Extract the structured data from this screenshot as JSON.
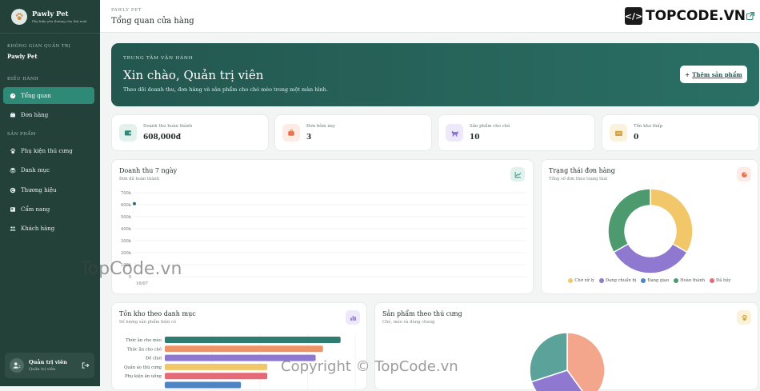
{
  "brand": {
    "name": "Pawly Pet",
    "tagline": "Phụ kiện yêu thương cho thú nuôi"
  },
  "sidebar": {
    "workspace_section": "KHÔNG GIAN QUẢN TRỊ",
    "workspace_name": "Pawly Pet",
    "ops_section": "ĐIỀU HÀNH",
    "products_section": "SẢN PHẨM",
    "items": [
      {
        "label": "Tổng quan",
        "icon": "dashboard-icon",
        "active": true
      },
      {
        "label": "Đơn hàng",
        "icon": "orders-icon",
        "active": false
      },
      {
        "label": "Phụ kiện thú cưng",
        "icon": "paw-icon",
        "active": false
      },
      {
        "label": "Danh mục",
        "icon": "layers-icon",
        "active": false
      },
      {
        "label": "Thương hiệu",
        "icon": "copyright-icon",
        "active": false
      },
      {
        "label": "Cẩm nang",
        "icon": "book-icon",
        "active": false
      },
      {
        "label": "Khách hàng",
        "icon": "users-icon",
        "active": false
      }
    ],
    "user": {
      "name": "Quản trị viên",
      "role": "Quản trị viên"
    }
  },
  "topbar": {
    "breadcrumb": "PAWLY PET",
    "title": "Tổng quan cửa hàng"
  },
  "hero": {
    "eyebrow": "TRUNG TÂM VẬN HÀNH",
    "title": "Xin chào, Quản trị viên",
    "subtitle": "Theo dõi doanh thu, đơn hàng và sản phẩm cho chó mèo trong một màn hình.",
    "button_label": "Thêm sản phẩm"
  },
  "stats": [
    {
      "label": "Doanh thu hoàn thành",
      "value": "608,000đ",
      "icon": "wallet-icon",
      "color": "#2e8a77",
      "bg": "#e3f1ed"
    },
    {
      "label": "Đơn hôm nay",
      "value": "3",
      "icon": "bag-icon",
      "color": "#e5734d",
      "bg": "#fdece5"
    },
    {
      "label": "Sản phẩm cho chó",
      "value": "10",
      "icon": "dog-icon",
      "color": "#8a72cf",
      "bg": "#eee9fa"
    },
    {
      "label": "Tồn kho thấp",
      "value": "0",
      "icon": "box-icon",
      "color": "#d9a23a",
      "bg": "#fbf2dc"
    }
  ],
  "revenue_card": {
    "title": "Doanh thu 7 ngày",
    "subtitle": "Đơn đã hoàn thành"
  },
  "status_card": {
    "title": "Trạng thái đơn hàng",
    "subtitle": "Tổng số đơn theo trạng thái"
  },
  "stock_card": {
    "title": "Tồn kho theo danh mục",
    "subtitle": "Số lượng sản phẩm hiện có"
  },
  "species_card": {
    "title": "Sản phẩm theo thú cưng",
    "subtitle": "Chó, mèo và dùng chung"
  },
  "chart_data": [
    {
      "type": "line",
      "x": [
        "16/07"
      ],
      "y_ticks": [
        "700k",
        "600k",
        "500k",
        "400k",
        "300k",
        "200k",
        "100k",
        "0"
      ],
      "ylim": [
        0,
        700000
      ],
      "series": [
        {
          "values": [
            608000
          ],
          "color": "#2e6b80"
        }
      ],
      "grid": true
    },
    {
      "type": "pie",
      "donut": true,
      "labels": [
        "Chờ xử lý",
        "Đang chuẩn bị",
        "Đang giao",
        "Hoàn thành",
        "Đã hủy"
      ],
      "values": [
        1,
        1,
        0,
        1,
        0
      ],
      "colors": [
        "#f2c76a",
        "#8f78cf",
        "#4f84c4",
        "#4c9a6e",
        "#e56a78"
      ],
      "legend": "bottom"
    },
    {
      "type": "bar",
      "orientation": "horizontal",
      "categories": [
        "Thức ăn cho mèo",
        "Thức ăn cho chó",
        "Đồ chơi",
        "Quần áo thú cưng",
        "Phụ kiện ăn uống",
        ""
      ],
      "values": [
        120,
        108,
        103,
        70,
        70,
        52
      ],
      "colors": [
        "#2e7d70",
        "#ef9467",
        "#8f78cf",
        "#f2c76a",
        "#e56a78",
        "#4f84c4"
      ],
      "xlim": [
        0,
        130
      ]
    },
    {
      "type": "pie",
      "values": [
        40,
        30,
        30
      ],
      "colors": [
        "#f3a68b",
        "#8f78cf",
        "#5aa29a"
      ]
    }
  ],
  "watermarks": {
    "top": "TOPCODE.VN",
    "middle": "TopCode.vn",
    "bottom": "Copyright © TopCode.vn"
  }
}
